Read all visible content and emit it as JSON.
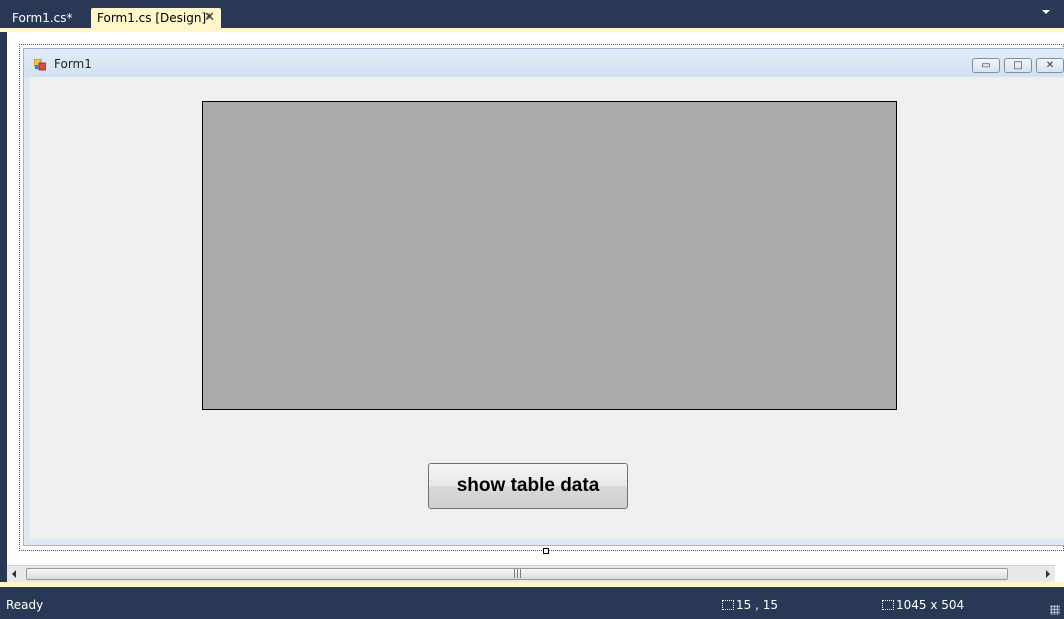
{
  "tabs": [
    {
      "label": "Form1.cs*",
      "active": false
    },
    {
      "label": "Form1.cs [Design]*",
      "active": true
    }
  ],
  "tab_close_glyph": "✕",
  "form": {
    "title": "Form1",
    "minimize_glyph": "▭",
    "maximize_glyph": "□",
    "close_glyph": "✕"
  },
  "button": {
    "label": "show table data"
  },
  "scrollbar": {
    "grip_glyph": "|||"
  },
  "status": {
    "ready": "Ready",
    "location": "15 , 15",
    "size": "1045 x 504"
  },
  "colors": {
    "chrome": "#293955",
    "accent": "#fff6c9",
    "datagrid": "#ababab",
    "form_background": "#f0f0f0"
  }
}
